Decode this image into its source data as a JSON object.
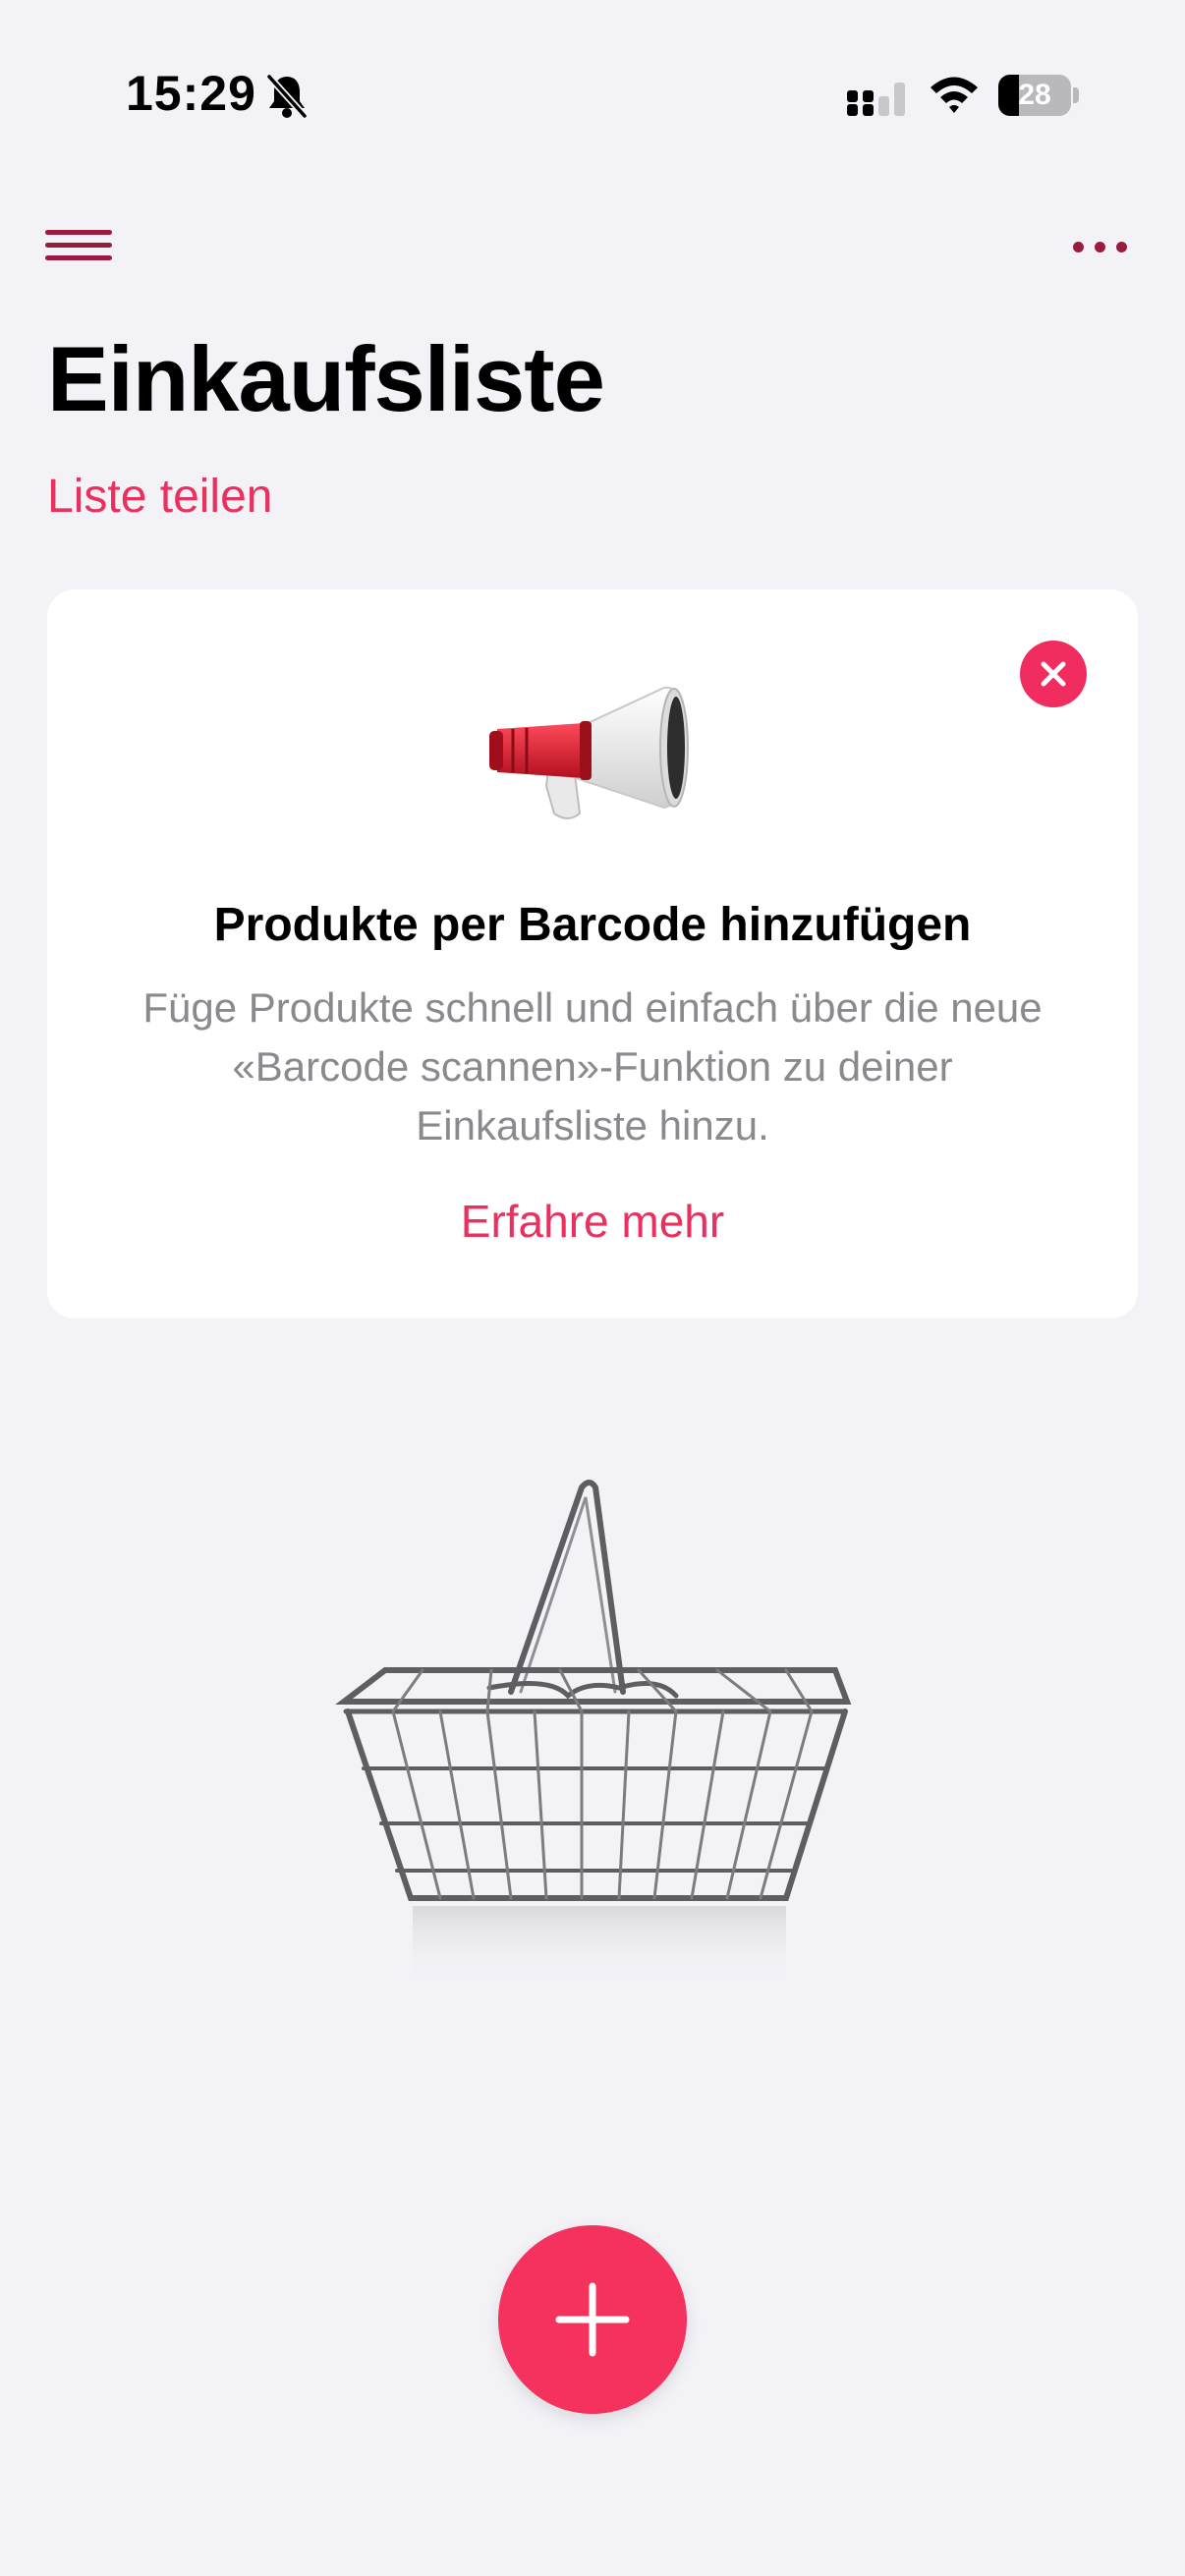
{
  "status_bar": {
    "time": "15:29",
    "battery_level": "28",
    "battery_fraction": 0.28,
    "icons": [
      "bell-slash-icon",
      "cellular-signal-icon",
      "wifi-icon",
      "battery-icon"
    ]
  },
  "nav": {
    "menu_icon": "hamburger-menu-icon",
    "more_icon": "ellipsis-icon"
  },
  "page": {
    "title": "Einkaufsliste",
    "share_label": "Liste teilen"
  },
  "promo_card": {
    "icon": "megaphone-icon",
    "close_icon": "close-icon",
    "title": "Produkte per Barcode hinzufügen",
    "body": "Füge Produkte schnell und einfach über die neue «Barcode scannen»-Funktion zu deiner Einkaufsliste hinzu.",
    "link_label": "Erfahre mehr"
  },
  "empty_state": {
    "illustration": "shopping-basket-illustration"
  },
  "fab": {
    "icon": "plus-icon"
  },
  "colors": {
    "accent": "#e8315e",
    "nav_icon": "#9b1b3f",
    "background": "#f2f2f7",
    "secondary_text": "#8a8a8e"
  }
}
